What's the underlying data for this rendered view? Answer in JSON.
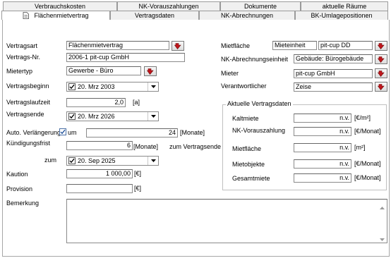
{
  "tabs_back": [
    {
      "label": "Verbrauchskosten"
    },
    {
      "label": "NK-Vorauszahlungen"
    },
    {
      "label": "Dokumente"
    },
    {
      "label": "aktuelle Räume"
    }
  ],
  "tabs_front": [
    {
      "label": "Flächenmietvertrag",
      "active": true
    },
    {
      "label": "Vertragsdaten"
    },
    {
      "label": "NK-Abrechnungen"
    },
    {
      "label": "BK-Umlagepositionen"
    }
  ],
  "left": {
    "vertragsart": {
      "label": "Vertragsart",
      "value": "Flächenmietvertrag"
    },
    "vertragsnr": {
      "label": "Vertrags-Nr.",
      "value": "2006-1 pit-cup GmbH"
    },
    "mietertyp": {
      "label": "Mietertyp",
      "value": "Gewerbe - Büro"
    },
    "vertragsbeginn": {
      "label": "Vertragsbeginn",
      "value": "20. Mrz 2003"
    },
    "vertragslaufzeit": {
      "label": "Vertragslaufzeit",
      "value": "2,0",
      "unit": "[a]"
    },
    "vertragsende": {
      "label": "Vertragsende",
      "value": "20. Mrz 2026"
    },
    "auto_verlaengerung": {
      "label": "Auto. Verlängerung",
      "checkbox_label": "um",
      "value": "24",
      "unit": "[Monate]"
    },
    "kuendigungsfrist": {
      "label": "Kündigungsfrist",
      "value": "6",
      "unit": "[Monate]",
      "suffix": "zum Vertragsende"
    },
    "zum": {
      "label": "zum",
      "value": "20. Sep 2025"
    },
    "kaution": {
      "label": "Kaution",
      "value": "1 000,00",
      "unit": "[€]"
    },
    "provision": {
      "label": "Provision",
      "value": "",
      "unit": "[€]"
    },
    "bemerkung": {
      "label": "Bemerkung",
      "value": ""
    }
  },
  "right": {
    "mietflaeche": {
      "label": "Mietfläche",
      "unit_value": "Mieteinheit",
      "value": "pit-cup DD"
    },
    "nk_einheit": {
      "label": "NK-Abrechnungseinheit",
      "value": "Gebäude: Bürogebäude"
    },
    "mieter": {
      "label": "Mieter",
      "value": "pit-cup GmbH"
    },
    "verantwortlicher": {
      "label": "Verantwortlicher",
      "value": "Zeise"
    }
  },
  "aktuell": {
    "title": "Aktuelle Vertragsdaten",
    "rows": [
      {
        "label": "Kaltmiete",
        "value": "n.v.",
        "unit": "[€/m²]"
      },
      {
        "label": "NK-Vorauszahlung",
        "value": "n.v.",
        "unit": "[€/Monat]"
      },
      {
        "label": "Mietfläche",
        "value": "n.v.",
        "unit": "[m²]"
      },
      {
        "label": "Mietobjekte",
        "value": "n.v.",
        "unit": "[€/Monat]"
      },
      {
        "label": "Gesamtmiete",
        "value": "n.v.",
        "unit": "[€/Monat]"
      }
    ]
  },
  "colors": {
    "pick_icon": "#c0151b",
    "checkbox_mark": "#1d4f9a"
  }
}
